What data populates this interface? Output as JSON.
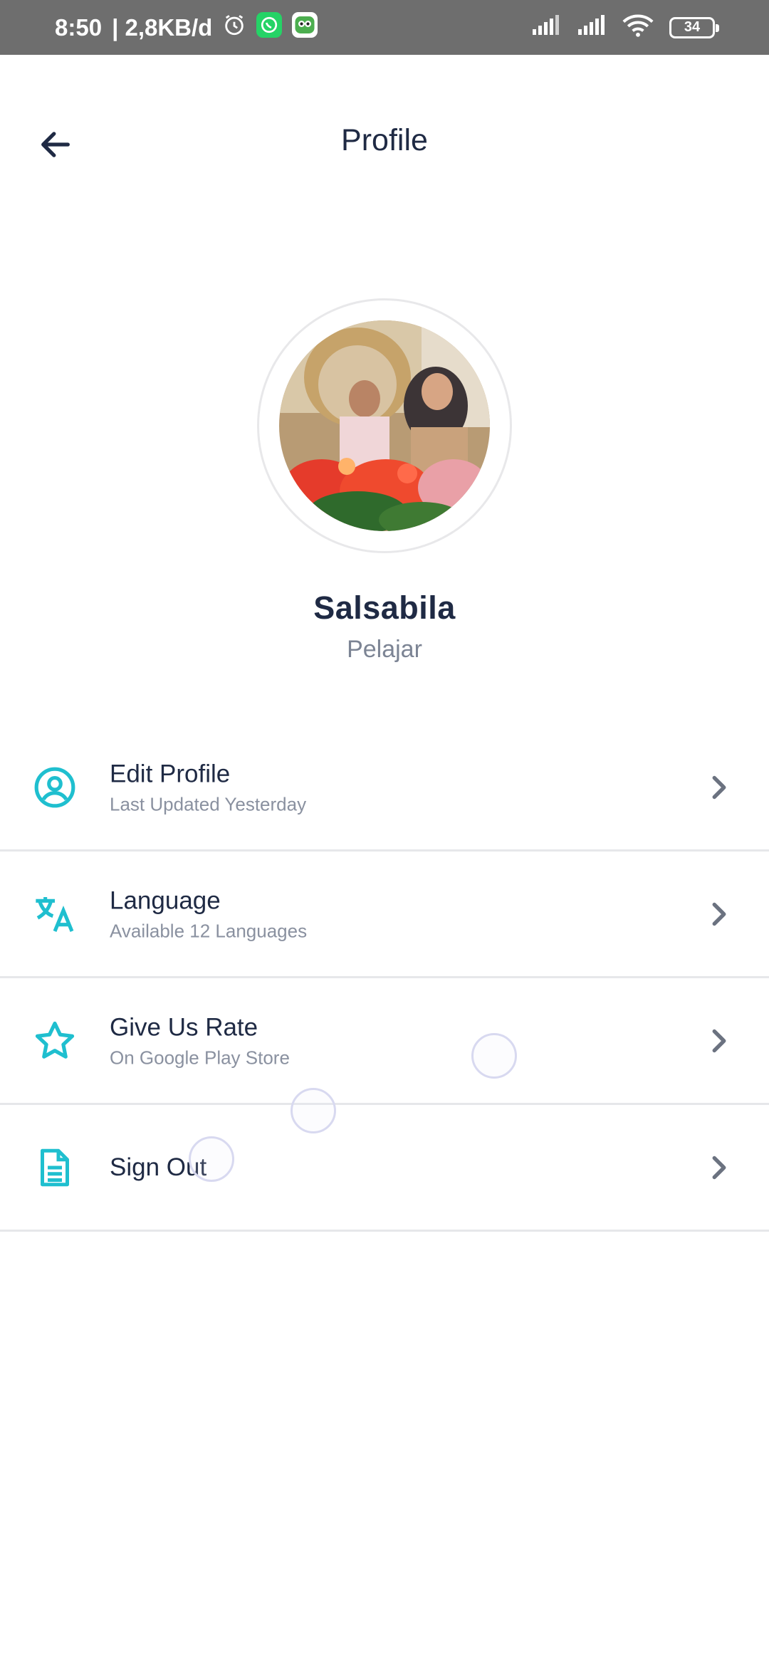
{
  "status_bar": {
    "time": "8:50",
    "network_speed": "| 2,8KB/d",
    "battery_level": "34",
    "icons": [
      "alarm-icon",
      "whatsapp-icon",
      "app-notification-icon",
      "signal-icon",
      "signal-icon",
      "wifi-icon",
      "battery-icon"
    ]
  },
  "header": {
    "title": "Profile",
    "back_icon": "arrow-left-icon"
  },
  "profile": {
    "name": "Salsabila",
    "role": "Pelajar"
  },
  "menu": {
    "items": [
      {
        "icon": "user-circle-icon",
        "title": "Edit Profile",
        "subtitle": "Last Updated Yesterday"
      },
      {
        "icon": "translate-icon",
        "title": "Language",
        "subtitle": "Available 12 Languages"
      },
      {
        "icon": "star-icon",
        "title": "Give Us Rate",
        "subtitle": "On Google Play Store"
      },
      {
        "icon": "document-icon",
        "title": "Sign Out",
        "subtitle": ""
      }
    ]
  },
  "colors": {
    "accent": "#1fbfcf",
    "text_primary": "#1f2a44",
    "text_secondary": "#8a91a0",
    "status_bar": "#6e6e6e",
    "divider": "#e6e7ea"
  }
}
